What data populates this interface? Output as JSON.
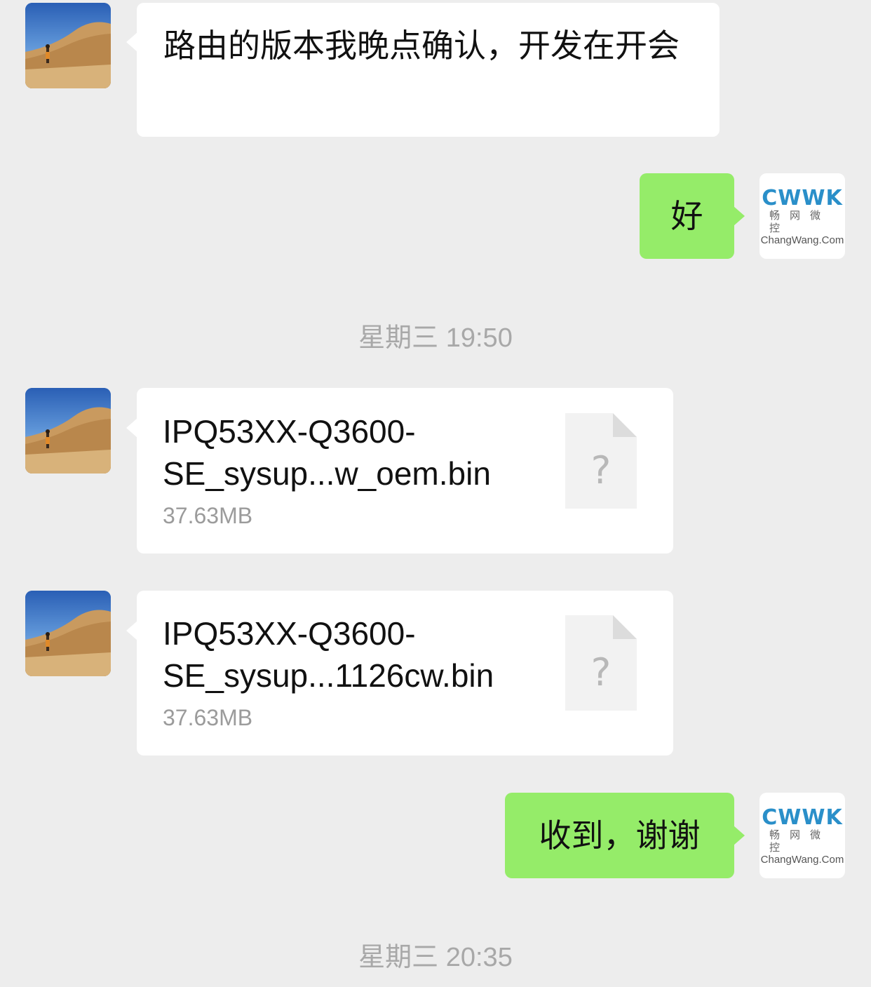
{
  "messages": [
    {
      "sender": "contact",
      "text": "路由的版本我晚点确认，开发在开会"
    },
    {
      "sender": "self",
      "text": "好"
    },
    {
      "timestamp": "星期三 19:50"
    },
    {
      "sender": "contact",
      "file_name": "IPQ53XX-Q3600-SE_sysup...w_oem.bin",
      "file_name_line1": "IPQ53XX-Q3600-",
      "file_name_line2": "SE_sysup...w_oem.bin",
      "file_size": "37.63MB",
      "icon": "unknown-file-icon"
    },
    {
      "sender": "contact",
      "file_name": "IPQ53XX-Q3600-SE_sysup...1126cw.bin",
      "file_name_line1": "IPQ53XX-Q3600-",
      "file_name_line2": "SE_sysup...1126cw.bin",
      "file_size": "37.63MB",
      "icon": "unknown-file-icon"
    },
    {
      "sender": "self",
      "text": "收到，谢谢"
    },
    {
      "timestamp": "星期三 20:35"
    }
  ],
  "self_avatar": {
    "logo_mark": "CWWK",
    "logo_cn": "畅网微控",
    "logo_en": "ChangWang.Com"
  },
  "contact_avatar": {
    "icon": "desert-photo-avatar"
  },
  "file_icon_glyph": "?",
  "colors": {
    "background": "#ededed",
    "bubble_self": "#95ec69",
    "bubble_contact": "#ffffff",
    "timestamp": "#a8a8a8",
    "logo": "#2a8fc9"
  }
}
